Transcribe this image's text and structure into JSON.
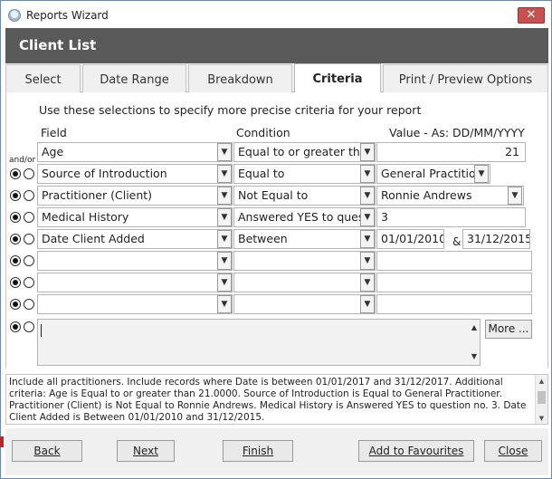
{
  "window": {
    "title": "Reports Wizard",
    "close_glyph": "✕",
    "app_icon": "app-icon"
  },
  "header": {
    "title": "Client List"
  },
  "tabs": [
    {
      "label": "Select"
    },
    {
      "label": "Date Range"
    },
    {
      "label": "Breakdown"
    },
    {
      "label": "Criteria",
      "active": true
    },
    {
      "label": "Print / Preview Options"
    }
  ],
  "criteria": {
    "instruction": "Use these selections to specify more precise criteria for your report",
    "headers": {
      "field": "Field",
      "condition": "Condition",
      "value": "Value - As: DD/MM/YYYY"
    },
    "andor_label": "and/or",
    "rows": [
      {
        "field": "Age",
        "condition": "Equal to or greater tha",
        "value": "21"
      },
      {
        "field": "Source of Introduction",
        "condition": "Equal to",
        "value": "General Practition"
      },
      {
        "field": "Practitioner (Client)",
        "condition": "Not Equal to",
        "value": "Ronnie Andrews"
      },
      {
        "field": "Medical History",
        "condition": "Answered YES to quest",
        "value": "3"
      },
      {
        "field": "Date Client Added",
        "condition": "Between",
        "value": "01/01/2010",
        "value2": "31/12/2015",
        "amp": "&"
      },
      {
        "field": "",
        "condition": "",
        "value": ""
      },
      {
        "field": "",
        "condition": "",
        "value": ""
      },
      {
        "field": "",
        "condition": "",
        "value": ""
      }
    ],
    "more_button": "More ..."
  },
  "summary": {
    "text": "Include all practitioners. Include records where Date is between 01/01/2017 and 31/12/2017. Additional criteria: Age is Equal to or greater than 21.0000. Source of Introduction is Equal to General Practitioner. Practitioner (Client) is Not Equal to Ronnie Andrews. Medical History is Answered YES to question no. 3. Date Client Added is Between 01/01/2010 and 31/12/2015."
  },
  "footer": {
    "back": {
      "label": "Back"
    },
    "next": {
      "label": "Next"
    },
    "finish": {
      "label": "Finish"
    },
    "add_favourites": {
      "label": "Add to Favourites"
    },
    "close": {
      "label": "Close"
    }
  },
  "colors": {
    "header_bg": "#5a5a5a",
    "close_bg": "#c75050"
  }
}
